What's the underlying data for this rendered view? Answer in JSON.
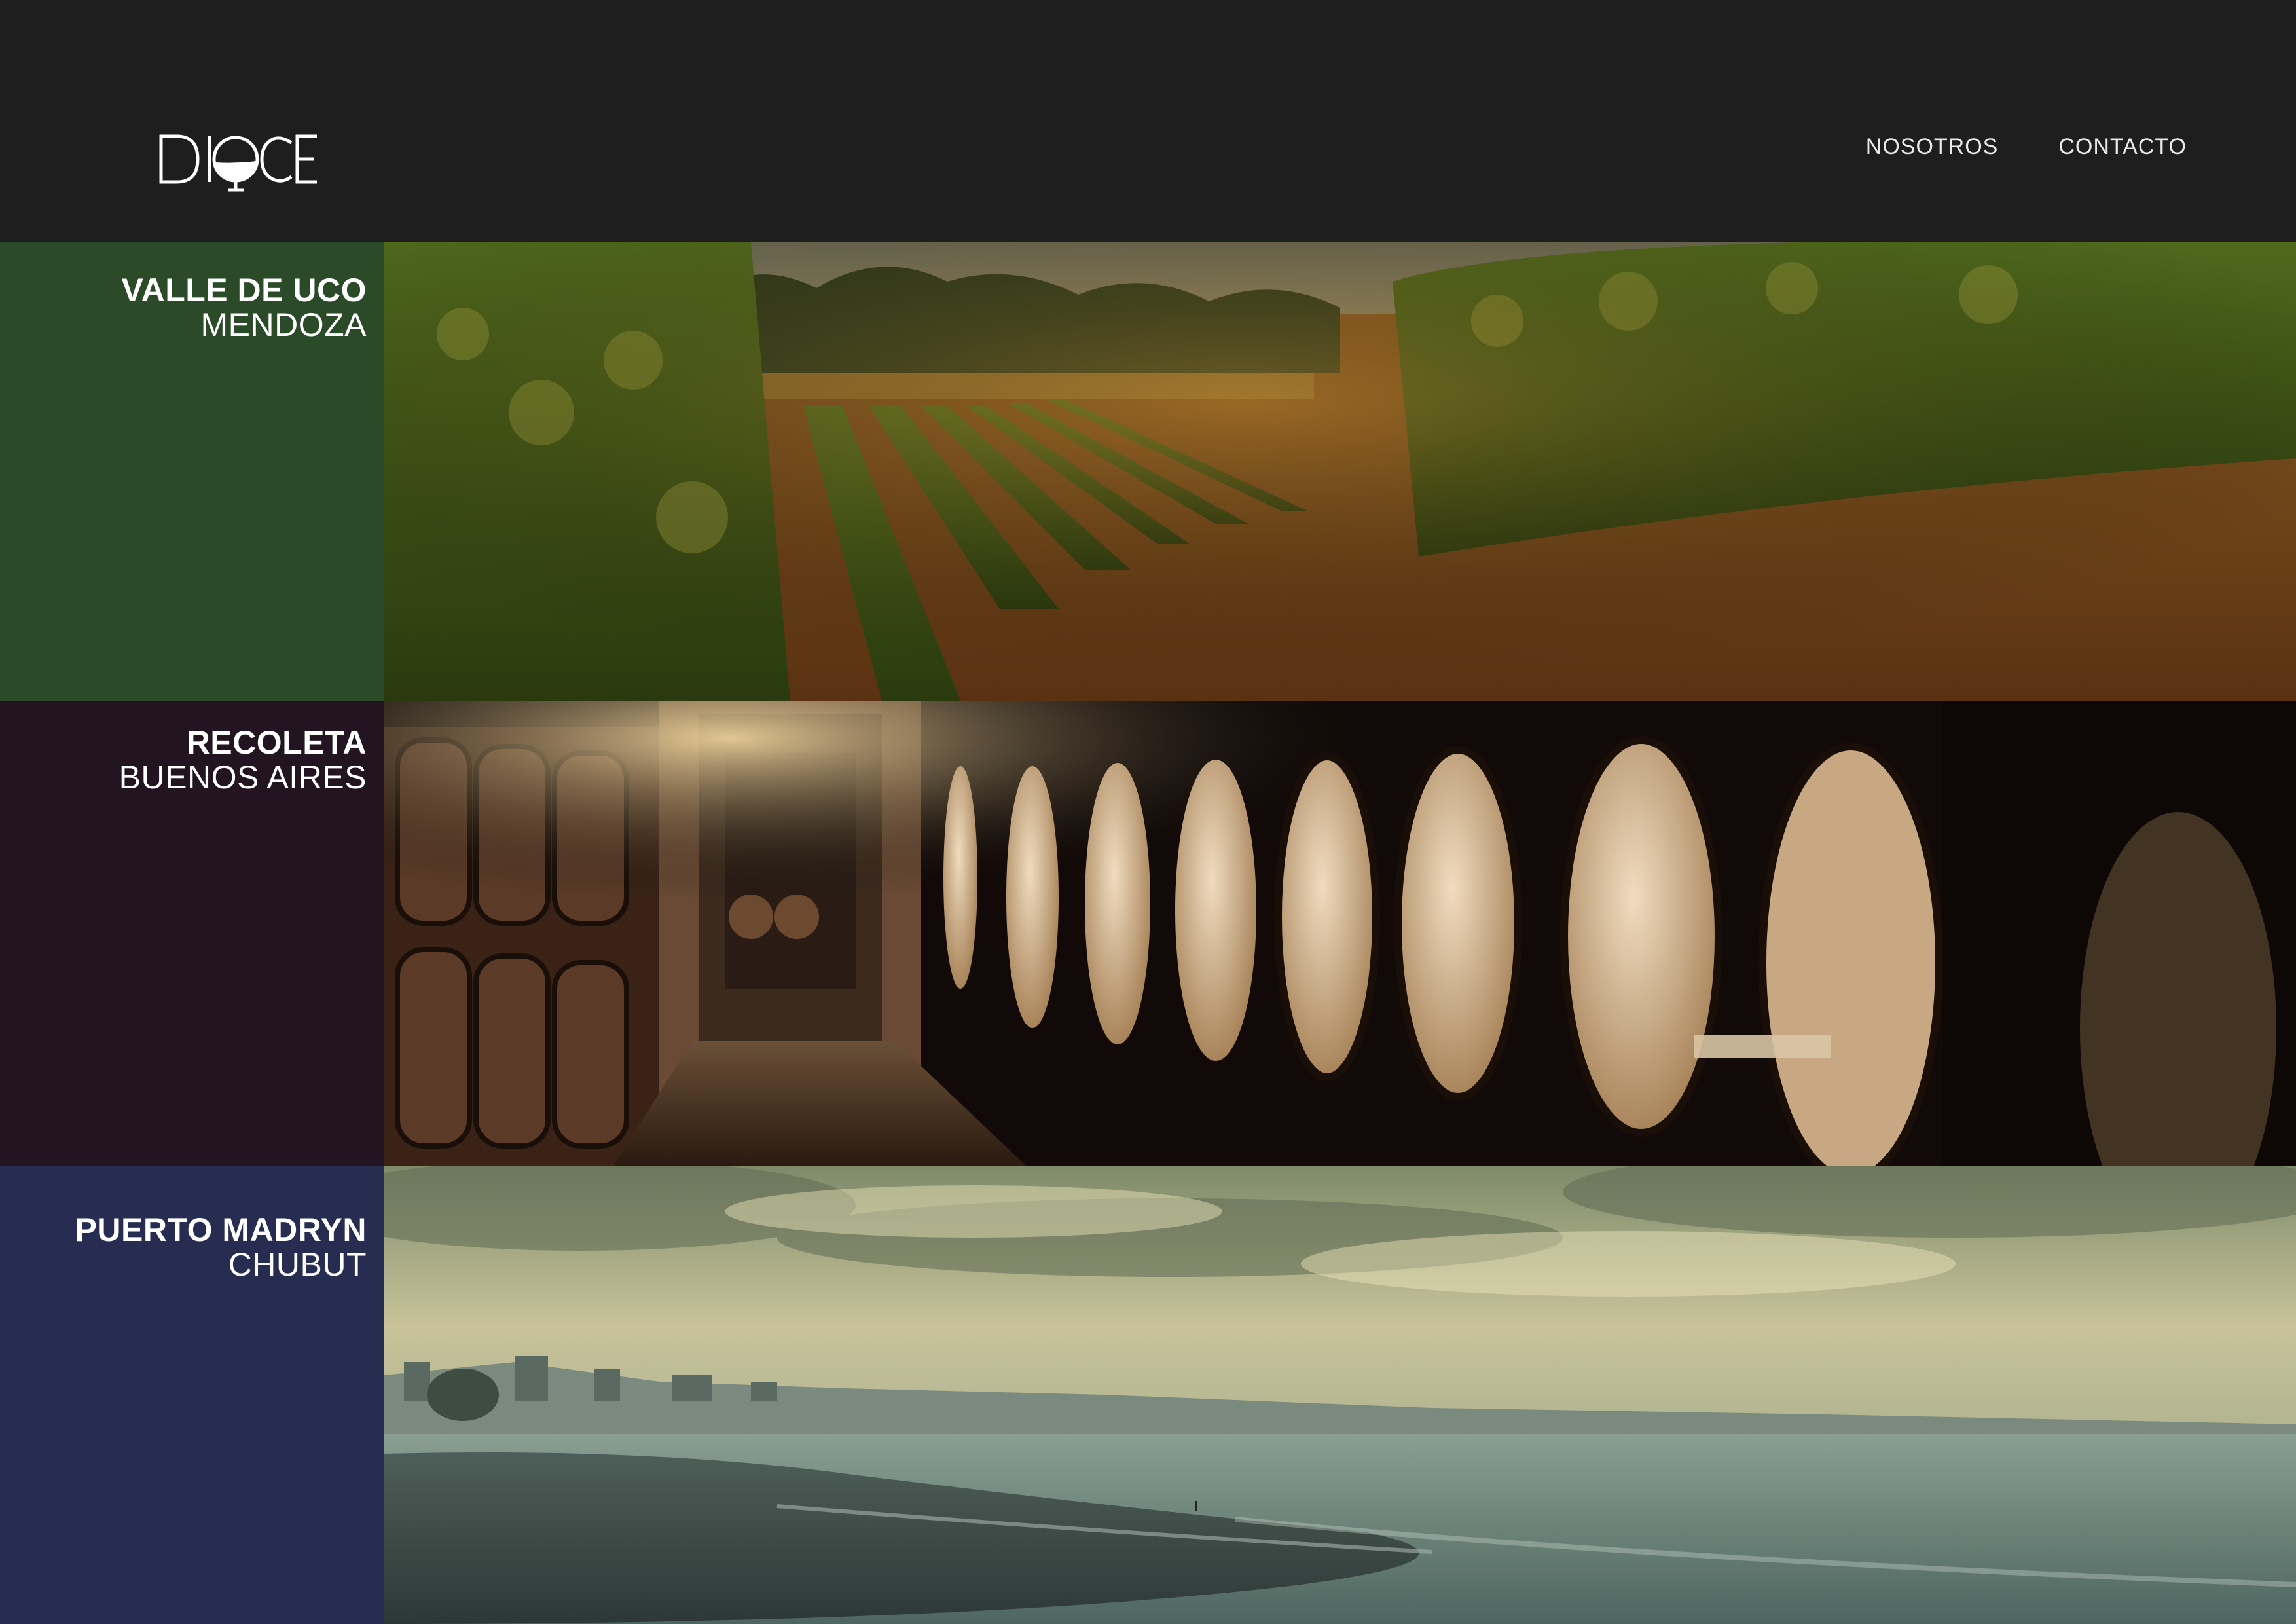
{
  "header": {
    "logo_text": "DIOCE",
    "nav": [
      {
        "label": "NOSOTROS"
      },
      {
        "label": "CONTACTO"
      }
    ]
  },
  "locations": [
    {
      "name": "VALLE DE UCO",
      "region": "MENDOZA",
      "panel_color": "#2b4a28",
      "photo": "vineyard"
    },
    {
      "name": "RECOLETA",
      "region": "BUENOS AIRES",
      "panel_color": "#221421",
      "photo": "wine-cellar-barrels"
    },
    {
      "name": "PUERTO MADRYN",
      "region": "CHUBUT",
      "panel_color": "#272d51",
      "photo": "beach-coastline"
    }
  ],
  "colors": {
    "header_bg": "#1e1e1e",
    "text": "#ffffff"
  }
}
